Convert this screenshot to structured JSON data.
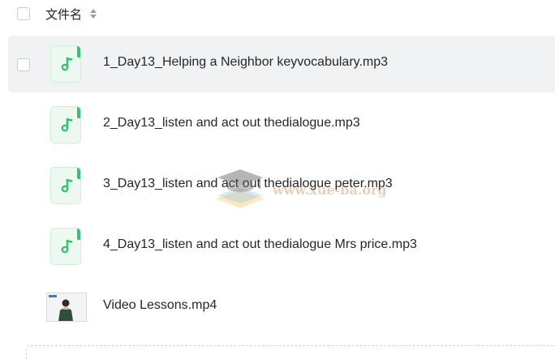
{
  "header": {
    "column_label": "文件名"
  },
  "files": [
    {
      "name": "1_Day13_Helping a Neighbor keyvocabulary.mp3",
      "type_icon": "audio-file-icon",
      "selected_hover": true
    },
    {
      "name": "2_Day13_listen and act out thedialogue.mp3",
      "type_icon": "audio-file-icon",
      "selected_hover": false
    },
    {
      "name": "3_Day13_listen and act out thedialogue peter.mp3",
      "type_icon": "audio-file-icon",
      "selected_hover": false
    },
    {
      "name": "4_Day13_listen and act out thedialogue Mrs price.mp3",
      "type_icon": "audio-file-icon",
      "selected_hover": false
    },
    {
      "name": "Video Lessons.mp4",
      "type_icon": "video-thumbnail",
      "selected_hover": false
    }
  ],
  "watermark": {
    "text": "www.xue-ba.org"
  },
  "colors": {
    "audio_icon_green": "#38c16f",
    "hover_row_bg": "#f1f2f4"
  }
}
